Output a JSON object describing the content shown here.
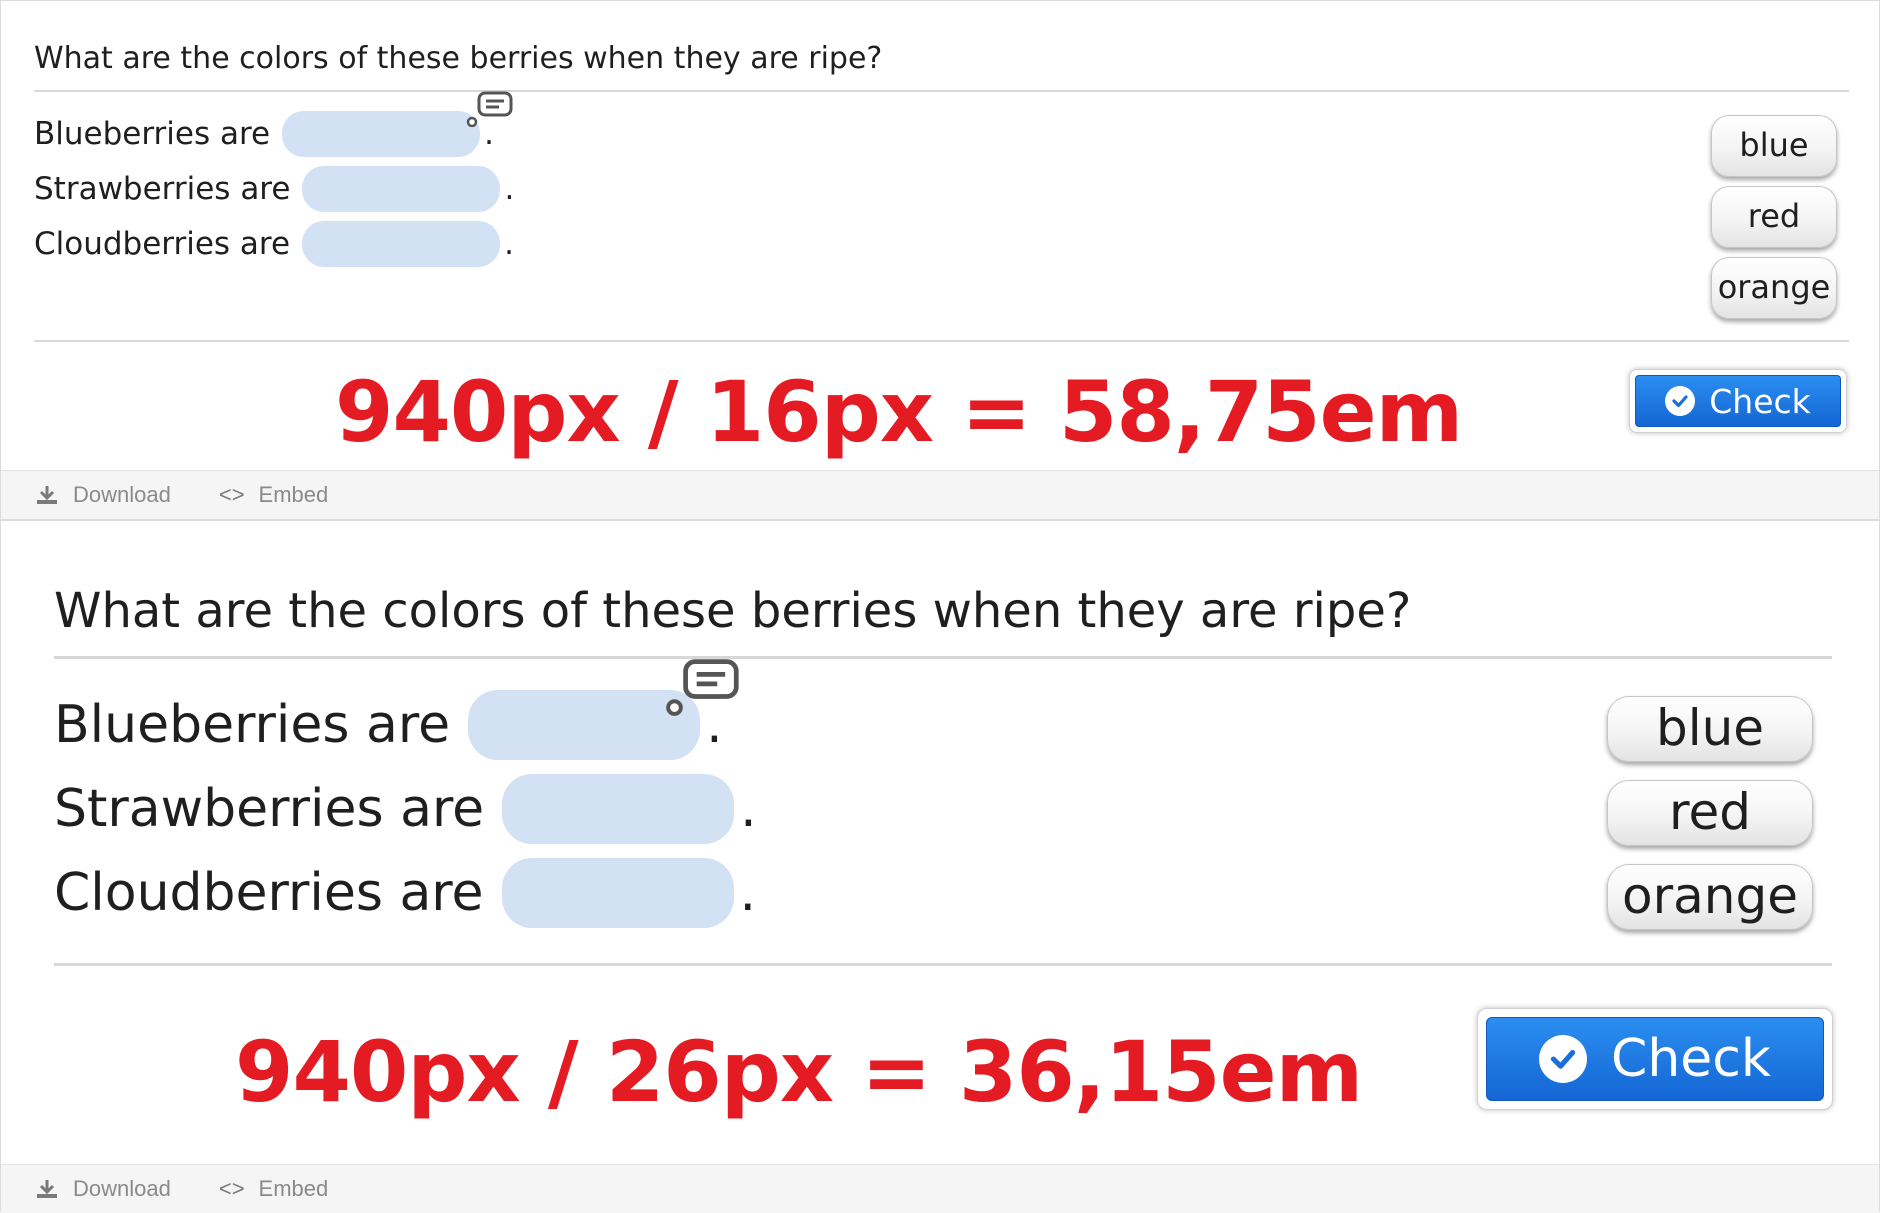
{
  "question": "What are the colors of these berries when they are ripe?",
  "sentences": [
    {
      "prefix": "Blueberries are",
      "suffix": "."
    },
    {
      "prefix": "Strawberries are",
      "suffix": "."
    },
    {
      "prefix": "Cloudberries are",
      "suffix": "."
    }
  ],
  "options": [
    "blue",
    "red",
    "orange"
  ],
  "check_label": "Check",
  "annotations": {
    "top": "940px / 16px = 58,75em",
    "bottom": "940px / 26px = 36,15em"
  },
  "footer": {
    "download": "Download",
    "embed": "Embed"
  },
  "colors": {
    "annotation": "#e51b24",
    "drop_zone": "#d2e2f4",
    "check_button": "#1a74e0"
  }
}
